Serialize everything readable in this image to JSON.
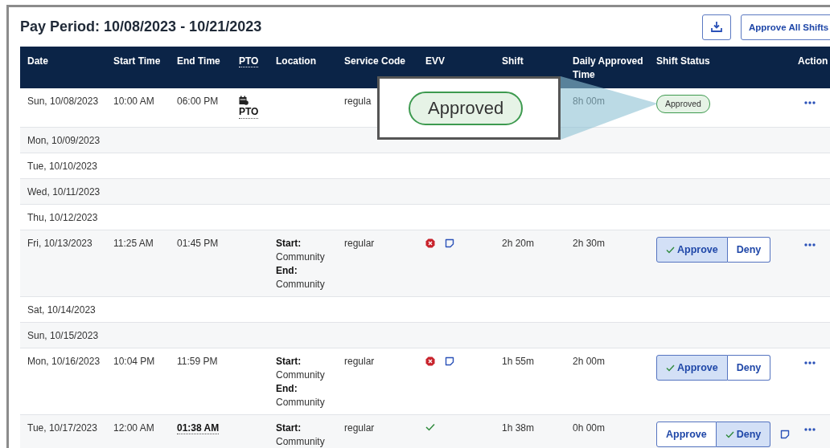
{
  "title": "Pay Period: 10/08/2023 - 10/21/2023",
  "toolbar": {
    "approve_all": "Approve All Shifts"
  },
  "columns": [
    {
      "label": "Date",
      "underline": false
    },
    {
      "label": "Start Time",
      "underline": false
    },
    {
      "label": "End Time",
      "underline": false
    },
    {
      "label": "PTO",
      "underline": true
    },
    {
      "label": "Location",
      "underline": false
    },
    {
      "label": "Service Code",
      "underline": false
    },
    {
      "label": "EVV",
      "underline": false
    },
    {
      "label": "Shift",
      "underline": false
    },
    {
      "label": "Daily Approved Time",
      "underline": false
    },
    {
      "label": "Shift Status",
      "underline": false
    },
    {
      "label": "Action",
      "underline": false
    }
  ],
  "rows": [
    {
      "date": "Sun, 10/08/2023",
      "start": "10:00 AM",
      "end": "06:00 PM",
      "end_flagged": false,
      "pto": "PTO",
      "service": "regula",
      "daily": "8h 00m",
      "status": {
        "kind": "badge",
        "text": "Approved"
      },
      "actions": true
    },
    {
      "date": "Mon, 10/09/2023"
    },
    {
      "date": "Tue, 10/10/2023"
    },
    {
      "date": "Wed, 10/11/2023"
    },
    {
      "date": "Thu, 10/12/2023"
    },
    {
      "date": "Fri, 10/13/2023",
      "start": "11:25 AM",
      "end": "01:45 PM",
      "end_flagged": false,
      "location": [
        {
          "label": "Start:",
          "value": "Community"
        },
        {
          "label": "End:",
          "value": "Community"
        }
      ],
      "service": "regular",
      "evv_compliant": false,
      "note": true,
      "duration": "2h 20m",
      "daily": "2h 30m",
      "status": {
        "kind": "decision",
        "approve": {
          "label": "Approve",
          "selected": true
        },
        "deny": {
          "label": "Deny",
          "selected": false
        }
      },
      "actions": true
    },
    {
      "date": "Sat, 10/14/2023"
    },
    {
      "date": "Sun, 10/15/2023"
    },
    {
      "date": "Mon, 10/16/2023",
      "start": "10:04 PM",
      "end": "11:59 PM",
      "end_flagged": false,
      "location": [
        {
          "label": "Start:",
          "value": "Community"
        },
        {
          "label": "End:",
          "value": "Community"
        }
      ],
      "service": "regular",
      "evv_compliant": false,
      "note": true,
      "duration": "1h 55m",
      "daily": "2h 00m",
      "status": {
        "kind": "decision",
        "approve": {
          "label": "Approve",
          "selected": true
        },
        "deny": {
          "label": "Deny",
          "selected": false
        }
      },
      "actions": true
    },
    {
      "date": "Tue, 10/17/2023",
      "start": "12:00 AM",
      "end": "01:38 AM",
      "end_flagged": true,
      "location": [
        {
          "label": "Start:",
          "value": "Community"
        }
      ],
      "service": "regular",
      "evv_compliant": true,
      "duration": "1h 38m",
      "daily": "0h 00m",
      "status": {
        "kind": "decision",
        "approve": {
          "label": "Approve",
          "selected": false
        },
        "deny": {
          "label": "Deny",
          "selected": true
        }
      },
      "action_note": true,
      "actions": true
    }
  ],
  "callout": {
    "text": "Approved"
  }
}
